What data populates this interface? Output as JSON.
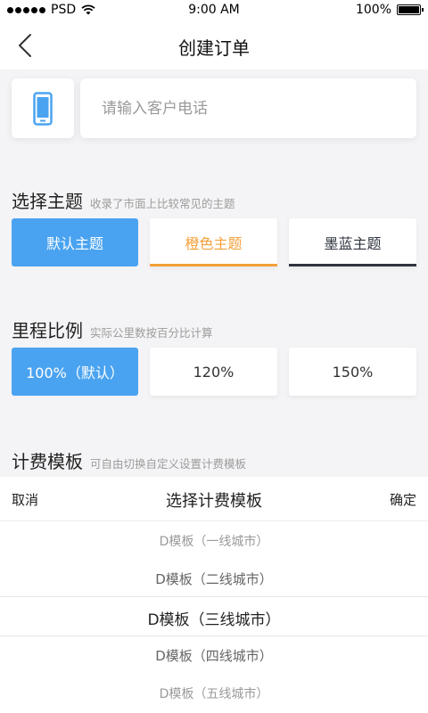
{
  "status": {
    "carrier": "PSD",
    "time": "9:00 AM",
    "battery": "100%"
  },
  "nav": {
    "title": "创建订单"
  },
  "phone": {
    "placeholder": "请输入客户电话",
    "value": ""
  },
  "theme": {
    "title": "选择主题",
    "subtitle": "收录了市面上比较常见的主题",
    "options": [
      {
        "label": "默认主题",
        "active": true
      },
      {
        "label": "橙色主题",
        "accent": "#f5a03a"
      },
      {
        "label": "墨蓝主题",
        "accent": "#2f3440"
      }
    ]
  },
  "mileage": {
    "title": "里程比例",
    "subtitle": "实际公里数按百分比计算",
    "options": [
      {
        "label": "100%（默认）",
        "active": true
      },
      {
        "label": "120%"
      },
      {
        "label": "150%"
      }
    ]
  },
  "template": {
    "title": "计费模板",
    "subtitle": "可自由切换自定义设置计费模板"
  },
  "picker": {
    "cancel": "取消",
    "title": "选择计费模板",
    "confirm": "确定",
    "items": [
      "D模板（一线城市）",
      "D模板（二线城市）",
      "D模板（三线城市）",
      "D模板（四线城市）",
      "D模板（五线城市）"
    ],
    "selected_index": 2
  },
  "colors": {
    "accent": "#4aa3f0",
    "orange": "#f5a03a",
    "navy": "#2f3440"
  }
}
